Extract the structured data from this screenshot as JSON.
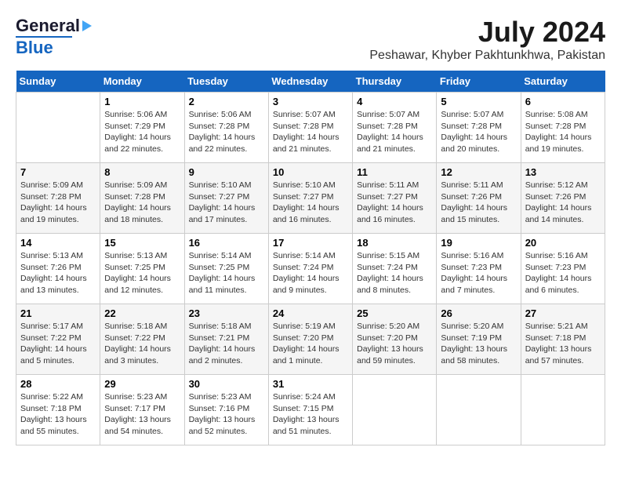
{
  "header": {
    "logo_line1": "General",
    "logo_line2": "Blue",
    "month": "July 2024",
    "location": "Peshawar, Khyber Pakhtunkhwa, Pakistan"
  },
  "days_of_week": [
    "Sunday",
    "Monday",
    "Tuesday",
    "Wednesday",
    "Thursday",
    "Friday",
    "Saturday"
  ],
  "weeks": [
    [
      {
        "day": "",
        "info": ""
      },
      {
        "day": "1",
        "info": "Sunrise: 5:06 AM\nSunset: 7:29 PM\nDaylight: 14 hours\nand 22 minutes."
      },
      {
        "day": "2",
        "info": "Sunrise: 5:06 AM\nSunset: 7:28 PM\nDaylight: 14 hours\nand 22 minutes."
      },
      {
        "day": "3",
        "info": "Sunrise: 5:07 AM\nSunset: 7:28 PM\nDaylight: 14 hours\nand 21 minutes."
      },
      {
        "day": "4",
        "info": "Sunrise: 5:07 AM\nSunset: 7:28 PM\nDaylight: 14 hours\nand 21 minutes."
      },
      {
        "day": "5",
        "info": "Sunrise: 5:07 AM\nSunset: 7:28 PM\nDaylight: 14 hours\nand 20 minutes."
      },
      {
        "day": "6",
        "info": "Sunrise: 5:08 AM\nSunset: 7:28 PM\nDaylight: 14 hours\nand 19 minutes."
      }
    ],
    [
      {
        "day": "7",
        "info": "Sunrise: 5:09 AM\nSunset: 7:28 PM\nDaylight: 14 hours\nand 19 minutes."
      },
      {
        "day": "8",
        "info": "Sunrise: 5:09 AM\nSunset: 7:28 PM\nDaylight: 14 hours\nand 18 minutes."
      },
      {
        "day": "9",
        "info": "Sunrise: 5:10 AM\nSunset: 7:27 PM\nDaylight: 14 hours\nand 17 minutes."
      },
      {
        "day": "10",
        "info": "Sunrise: 5:10 AM\nSunset: 7:27 PM\nDaylight: 14 hours\nand 16 minutes."
      },
      {
        "day": "11",
        "info": "Sunrise: 5:11 AM\nSunset: 7:27 PM\nDaylight: 14 hours\nand 16 minutes."
      },
      {
        "day": "12",
        "info": "Sunrise: 5:11 AM\nSunset: 7:26 PM\nDaylight: 14 hours\nand 15 minutes."
      },
      {
        "day": "13",
        "info": "Sunrise: 5:12 AM\nSunset: 7:26 PM\nDaylight: 14 hours\nand 14 minutes."
      }
    ],
    [
      {
        "day": "14",
        "info": "Sunrise: 5:13 AM\nSunset: 7:26 PM\nDaylight: 14 hours\nand 13 minutes."
      },
      {
        "day": "15",
        "info": "Sunrise: 5:13 AM\nSunset: 7:25 PM\nDaylight: 14 hours\nand 12 minutes."
      },
      {
        "day": "16",
        "info": "Sunrise: 5:14 AM\nSunset: 7:25 PM\nDaylight: 14 hours\nand 11 minutes."
      },
      {
        "day": "17",
        "info": "Sunrise: 5:14 AM\nSunset: 7:24 PM\nDaylight: 14 hours\nand 9 minutes."
      },
      {
        "day": "18",
        "info": "Sunrise: 5:15 AM\nSunset: 7:24 PM\nDaylight: 14 hours\nand 8 minutes."
      },
      {
        "day": "19",
        "info": "Sunrise: 5:16 AM\nSunset: 7:23 PM\nDaylight: 14 hours\nand 7 minutes."
      },
      {
        "day": "20",
        "info": "Sunrise: 5:16 AM\nSunset: 7:23 PM\nDaylight: 14 hours\nand 6 minutes."
      }
    ],
    [
      {
        "day": "21",
        "info": "Sunrise: 5:17 AM\nSunset: 7:22 PM\nDaylight: 14 hours\nand 5 minutes."
      },
      {
        "day": "22",
        "info": "Sunrise: 5:18 AM\nSunset: 7:22 PM\nDaylight: 14 hours\nand 3 minutes."
      },
      {
        "day": "23",
        "info": "Sunrise: 5:18 AM\nSunset: 7:21 PM\nDaylight: 14 hours\nand 2 minutes."
      },
      {
        "day": "24",
        "info": "Sunrise: 5:19 AM\nSunset: 7:20 PM\nDaylight: 14 hours\nand 1 minute."
      },
      {
        "day": "25",
        "info": "Sunrise: 5:20 AM\nSunset: 7:20 PM\nDaylight: 13 hours\nand 59 minutes."
      },
      {
        "day": "26",
        "info": "Sunrise: 5:20 AM\nSunset: 7:19 PM\nDaylight: 13 hours\nand 58 minutes."
      },
      {
        "day": "27",
        "info": "Sunrise: 5:21 AM\nSunset: 7:18 PM\nDaylight: 13 hours\nand 57 minutes."
      }
    ],
    [
      {
        "day": "28",
        "info": "Sunrise: 5:22 AM\nSunset: 7:18 PM\nDaylight: 13 hours\nand 55 minutes."
      },
      {
        "day": "29",
        "info": "Sunrise: 5:23 AM\nSunset: 7:17 PM\nDaylight: 13 hours\nand 54 minutes."
      },
      {
        "day": "30",
        "info": "Sunrise: 5:23 AM\nSunset: 7:16 PM\nDaylight: 13 hours\nand 52 minutes."
      },
      {
        "day": "31",
        "info": "Sunrise: 5:24 AM\nSunset: 7:15 PM\nDaylight: 13 hours\nand 51 minutes."
      },
      {
        "day": "",
        "info": ""
      },
      {
        "day": "",
        "info": ""
      },
      {
        "day": "",
        "info": ""
      }
    ]
  ]
}
